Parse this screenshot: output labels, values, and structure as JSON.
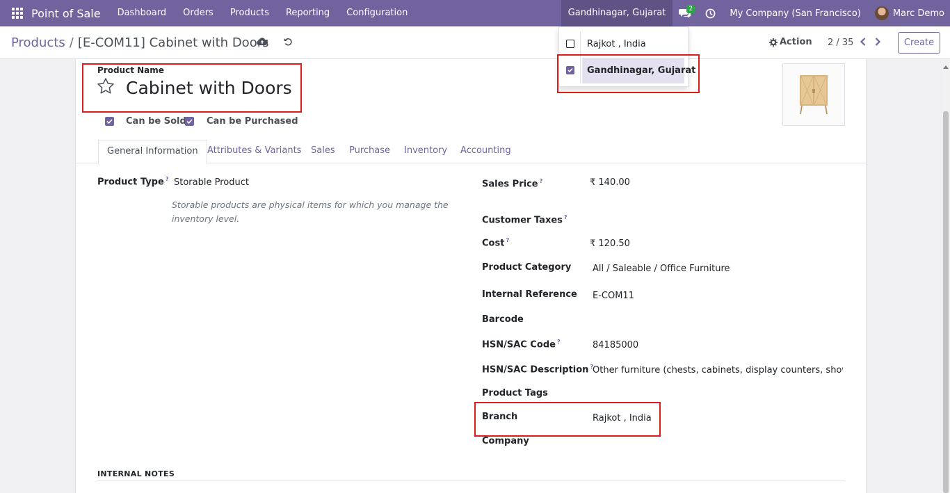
{
  "navbar": {
    "app_name": "Point of Sale",
    "menu": [
      "Dashboard",
      "Orders",
      "Products",
      "Reporting",
      "Configuration"
    ],
    "branch": "Gandhinagar, Gujarat",
    "chat_count": "2",
    "company": "My Company (San Francisco)",
    "user": "Marc Demo"
  },
  "control_panel": {
    "breadcrumb_parent": "Products",
    "breadcrumb_sep": "/",
    "breadcrumb_current": "[E-COM11] Cabinet with Doors",
    "action_label": "Action",
    "pager": "2 / 35",
    "create_label": "Create"
  },
  "branch_dropdown": {
    "items": [
      {
        "label": "Rajkot , India",
        "checked": false
      },
      {
        "label": "Gandhinagar, Gujarat",
        "checked": true
      }
    ]
  },
  "form": {
    "name_label": "Product Name",
    "product_name": "Cabinet with Doors",
    "can_be_sold": "Can be Sold",
    "can_be_purchased": "Can be Purchased",
    "tabs": [
      "General Information",
      "Attributes & Variants",
      "Sales",
      "Purchase",
      "Inventory",
      "Accounting"
    ],
    "product_type_label": "Product Type",
    "product_type_value": "Storable Product",
    "product_type_help": "Storable products are physical items for which you manage the inventory level.",
    "sales_price_label": "Sales Price",
    "sales_price_value": "₹ 140.00",
    "customer_taxes_label": "Customer Taxes",
    "cost_label": "Cost",
    "cost_value": "₹ 120.50",
    "category_label": "Product Category",
    "category_value": "All / Saleable / Office Furniture",
    "internal_ref_label": "Internal Reference",
    "internal_ref_value": "E-COM11",
    "barcode_label": "Barcode",
    "hsn_code_label": "HSN/SAC Code",
    "hsn_code_value": "84185000",
    "hsn_desc_label": "HSN/SAC Description",
    "hsn_desc_value": "Other furniture (chests, cabinets, display counters, show-case",
    "tags_label": "Product Tags",
    "branch_label": "Branch",
    "branch_value": "Rajkot , India",
    "company_label": "Company",
    "help_mark": "?",
    "internal_notes_label": "INTERNAL NOTES"
  },
  "colors": {
    "brand": "#71639e",
    "highlight_box": "#d91c1c",
    "chat_badge": "#28a745"
  }
}
